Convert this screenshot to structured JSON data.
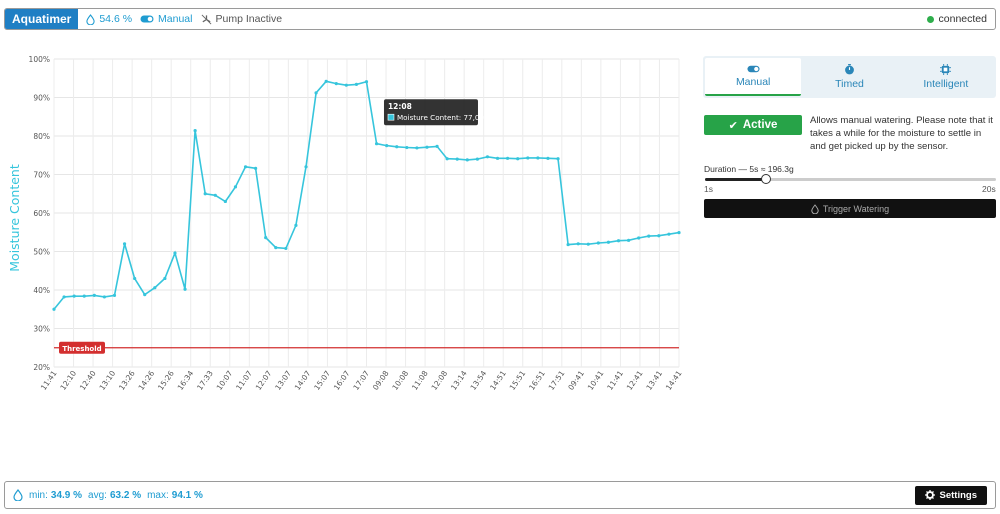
{
  "header": {
    "brand": "Aquatimer",
    "moisture": "54.6 %",
    "mode": "Manual",
    "pump": "Pump Inactive",
    "connection": "connected"
  },
  "tabs": [
    {
      "label": "Manual",
      "icon": "toggle-icon"
    },
    {
      "label": "Timed",
      "icon": "timer-icon"
    },
    {
      "label": "Intelligent",
      "icon": "chip-icon"
    }
  ],
  "manual": {
    "active_label": "Active",
    "description": "Allows manual watering. Please note that it takes a while for the moisture to settle in and get picked up by the sensor.",
    "duration_label": "Duration — 5s ≈ 196.3g",
    "slider_min": "1s",
    "slider_max": "20s",
    "slider_value": 5,
    "slider_range": [
      1,
      20
    ],
    "trigger_label": "Trigger Watering"
  },
  "footer": {
    "min_label": "min:",
    "min_value": "34.9 %",
    "avg_label": "avg:",
    "avg_value": "63.2 %",
    "max_label": "max:",
    "max_value": "94.1 %",
    "settings_label": "Settings"
  },
  "colors": {
    "line": "#36c5dc",
    "threshold": "#d32f2f",
    "brand": "#1f7fc4",
    "active": "#27a348"
  },
  "chart_data": {
    "type": "line",
    "ylabel": "Moisture Content",
    "ylim": [
      20,
      100
    ],
    "yticks": [
      "20%",
      "30%",
      "40%",
      "50%",
      "60%",
      "70%",
      "80%",
      "90%",
      "100%"
    ],
    "xticks": [
      "11:41",
      "12:10",
      "12:40",
      "13:10",
      "13:26",
      "14:26",
      "15:26",
      "16:34",
      "17:33",
      "10:07",
      "11:07",
      "12:07",
      "13:07",
      "14:07",
      "15:07",
      "16:07",
      "17:07",
      "09:08",
      "10:08",
      "11:08",
      "12:08",
      "13:14",
      "13:54",
      "14:51",
      "15:51",
      "16:51",
      "17:51",
      "09:41",
      "10:41",
      "11:41",
      "12:41",
      "13:41",
      "14:41"
    ],
    "threshold_label": "Threshold",
    "threshold_value": 25,
    "tooltip": {
      "time": "12:08",
      "text": "Moisture Content: 77,09"
    },
    "grid": true,
    "series": [
      {
        "values": [
          35.0,
          38.2,
          38.4,
          38.4,
          38.6,
          38.2,
          38.6,
          52.0,
          43.0,
          38.8,
          40.6,
          43.0,
          49.6,
          40.2,
          81.4,
          65.0,
          64.6,
          63.0,
          66.8,
          72.0,
          71.6,
          53.6,
          51.0,
          50.8,
          56.8,
          72.0,
          91.2,
          94.2,
          93.6,
          93.2,
          93.4,
          94.1,
          78.0,
          77.5,
          77.2,
          77.0,
          76.9,
          77.09,
          77.3,
          74.1,
          74.0,
          73.8,
          74.0,
          74.6,
          74.2,
          74.2,
          74.1,
          74.3,
          74.3,
          74.2,
          74.1,
          51.8,
          52.0,
          51.9,
          52.2,
          52.4,
          52.8,
          52.9,
          53.5,
          54.0,
          54.1,
          54.5,
          54.9
        ]
      }
    ]
  }
}
